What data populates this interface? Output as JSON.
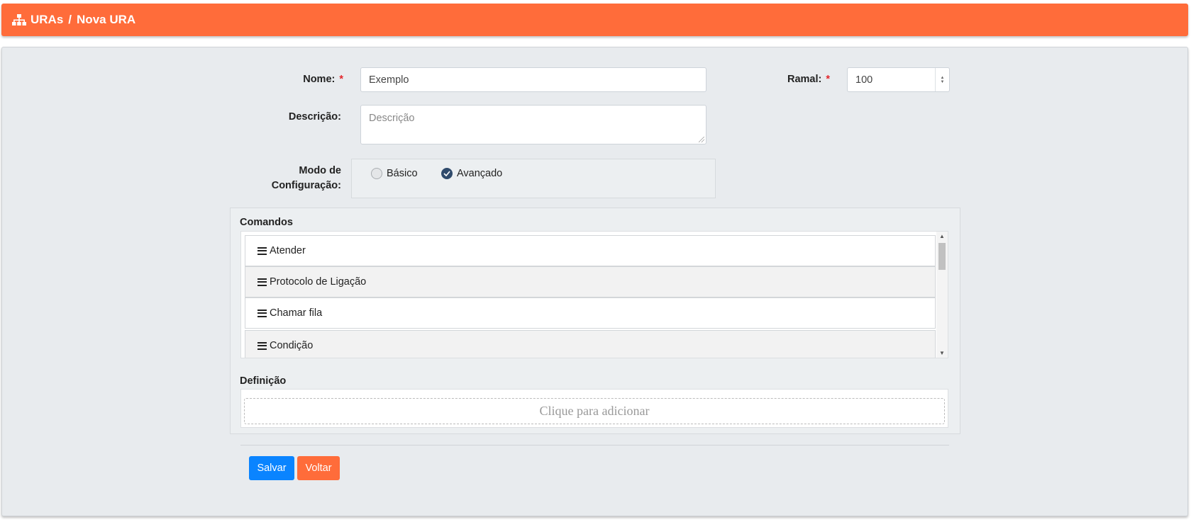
{
  "breadcrumb": {
    "root": "URAs",
    "separator": "/",
    "current": "Nova URA"
  },
  "form": {
    "nome": {
      "label": "Nome:",
      "required_mark": "*",
      "value": "Exemplo"
    },
    "ramal": {
      "label": "Ramal:",
      "required_mark": "*",
      "value": "100"
    },
    "descricao": {
      "label": "Descrição:",
      "placeholder": "Descrição"
    },
    "modo": {
      "label_line1": "Modo de",
      "label_line2": "Configuração:",
      "options": [
        {
          "label": "Básico",
          "selected": false
        },
        {
          "label": "Avançado",
          "selected": true
        }
      ]
    }
  },
  "comandos": {
    "title": "Comandos",
    "items": [
      "Atender",
      "Protocolo de Ligação",
      "Chamar fila",
      "Condição"
    ]
  },
  "definicao": {
    "title": "Definição",
    "placeholder": "Clique para adicionar"
  },
  "actions": {
    "save_label": "Salvar",
    "back_label": "Voltar"
  },
  "colors": {
    "header": "#ff6c3a",
    "save": "#0a84ff",
    "back": "#ff6c3a",
    "radio_selected": "#2f4a6b"
  },
  "icons": {
    "breadcrumb": "sitemap-icon",
    "list_item": "bars-icon"
  }
}
